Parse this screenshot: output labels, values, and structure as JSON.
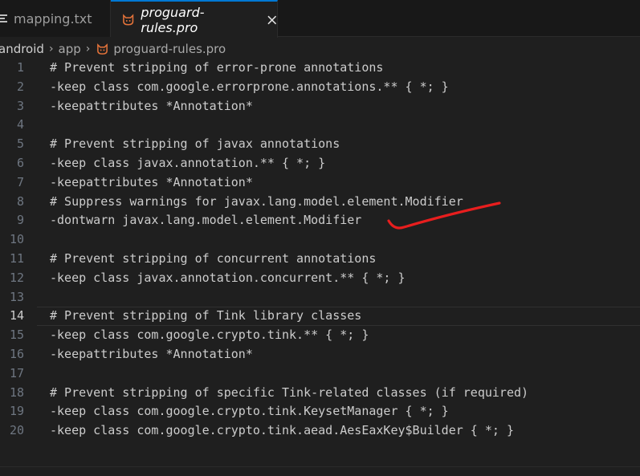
{
  "tabs": [
    {
      "label": "mapping.txt",
      "icon": "text-lines-icon",
      "active": false
    },
    {
      "label": "proguard-rules.pro",
      "icon": "proguard-cat-icon",
      "active": true
    }
  ],
  "breadcrumb": {
    "items": [
      "android",
      "app",
      "proguard-rules.pro"
    ],
    "separator": "›"
  },
  "editor": {
    "current_line": 14,
    "lines": [
      {
        "n": "1",
        "text": "# Prevent stripping of error-prone annotations"
      },
      {
        "n": "2",
        "text": "-keep class com.google.errorprone.annotations.** { *; }"
      },
      {
        "n": "3",
        "text": "-keepattributes *Annotation*"
      },
      {
        "n": "4",
        "text": ""
      },
      {
        "n": "5",
        "text": "# Prevent stripping of javax annotations"
      },
      {
        "n": "6",
        "text": "-keep class javax.annotation.** { *; }"
      },
      {
        "n": "7",
        "text": "-keepattributes *Annotation*"
      },
      {
        "n": "8",
        "text": "# Suppress warnings for javax.lang.model.element.Modifier"
      },
      {
        "n": "9",
        "text": "-dontwarn javax.lang.model.element.Modifier"
      },
      {
        "n": "10",
        "text": ""
      },
      {
        "n": "11",
        "text": "# Prevent stripping of concurrent annotations"
      },
      {
        "n": "12",
        "text": "-keep class javax.annotation.concurrent.** { *; }"
      },
      {
        "n": "13",
        "text": ""
      },
      {
        "n": "14",
        "text": "# Prevent stripping of Tink library classes"
      },
      {
        "n": "15",
        "text": "-keep class com.google.crypto.tink.** { *; }"
      },
      {
        "n": "16",
        "text": "-keepattributes *Annotation*"
      },
      {
        "n": "17",
        "text": ""
      },
      {
        "n": "18",
        "text": "# Prevent stripping of specific Tink-related classes (if required)"
      },
      {
        "n": "19",
        "text": "-keep class com.google.crypto.tink.KeysetManager { *; }"
      },
      {
        "n": "20",
        "text": "-keep class com.google.crypto.tink.aead.AesEaxKey$Builder { *; }"
      }
    ]
  },
  "colors": {
    "accent": "#0078d4",
    "annotation_stroke": "#e81e1e",
    "icon_orange": "#e5733a"
  }
}
